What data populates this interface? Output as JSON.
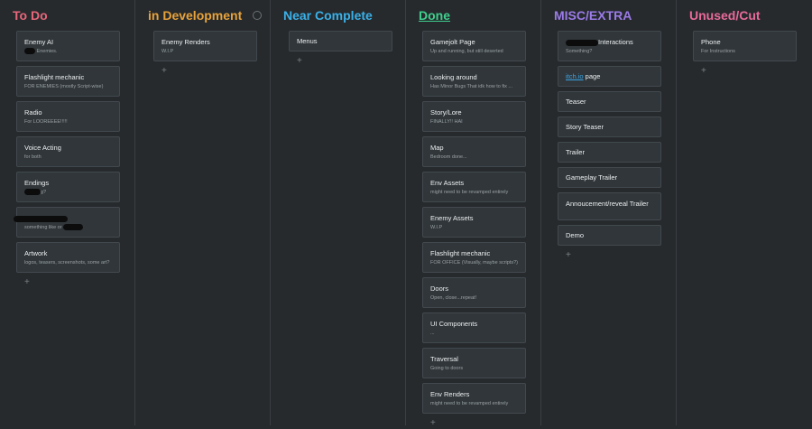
{
  "columns": [
    {
      "title": "To Do",
      "color": "#e8667a",
      "cards": [
        {
          "title": "Enemy AI",
          "sub": "Enemies."
        },
        {
          "title": "Flashlight mechanic",
          "sub": "FOR ENEMIES (mostly Script-wise)"
        },
        {
          "title": "Radio",
          "sub": "For LOOREEEE!!!!!"
        },
        {
          "title": "Voice Acting",
          "sub": "for both"
        },
        {
          "title": "Endings",
          "sub": "g?"
        },
        {
          "title": "",
          "sub": "something like or"
        },
        {
          "title": "Artwork",
          "sub": "logos, teasers, screenshots, some art?"
        }
      ],
      "add": "+"
    },
    {
      "title": "in Development",
      "color": "#e8a23a",
      "cards": [
        {
          "title": "Enemy Renders",
          "sub": "W.I.P"
        }
      ],
      "add": "+"
    },
    {
      "title": "Near Complete",
      "color": "#3ab0e8",
      "cards": [
        {
          "title": "Menus",
          "sub": ""
        }
      ],
      "add": "+"
    },
    {
      "title": "Done",
      "color": "#3fcf8e",
      "cards": [
        {
          "title": "Gamejolt Page",
          "sub": "Up and running, but still deserted"
        },
        {
          "title": "Looking around",
          "sub": "Has Minor Bugs That idk how to fix ..."
        },
        {
          "title": "Story/Lore",
          "sub": "FINALLY!! HAI"
        },
        {
          "title": "Map",
          "sub": "Bedroom done..."
        },
        {
          "title": "Env Assets",
          "sub": "might need to be revamped entirely"
        },
        {
          "title": "Enemy Assets",
          "sub": "W.I.P"
        },
        {
          "title": "Flashlight mechanic",
          "sub": "FOR OFFICE (Visually, maybe scripts?)"
        },
        {
          "title": "Doors",
          "sub": "Open, close...repeat!"
        },
        {
          "title": "UI Components",
          "sub": "..."
        },
        {
          "title": "Traversal",
          "sub": "Going to doors"
        },
        {
          "title": "Env Renders",
          "sub": "might need to be revamped entirely"
        }
      ],
      "add": "+"
    },
    {
      "title": "MISC/EXTRA",
      "color": "#9b7be8",
      "cards": [
        {
          "title": "Interactions",
          "sub": "Something?"
        },
        {
          "title_link": "itch.io",
          "title_rest": " page",
          "sub": ""
        },
        {
          "title": "Teaser",
          "sub": ""
        },
        {
          "title": "Story Teaser",
          "sub": ""
        },
        {
          "title": "Trailer",
          "sub": ""
        },
        {
          "title": "Gameplay Trailer",
          "sub": ""
        },
        {
          "title": "Annoucement/reveal Trailer",
          "sub": ""
        },
        {
          "title": "Demo",
          "sub": ""
        }
      ],
      "add": "+"
    },
    {
      "title": "Unused/Cut",
      "color": "#e86a9a",
      "cards": [
        {
          "title": "Phone",
          "sub": "For Instructions"
        }
      ],
      "add": "+"
    }
  ]
}
